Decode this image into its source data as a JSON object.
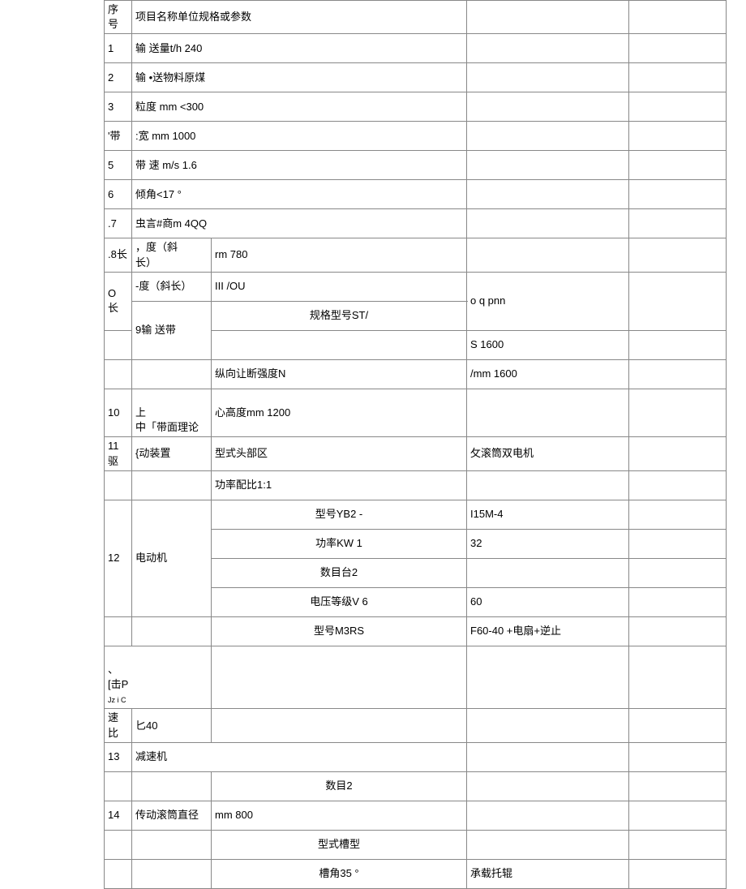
{
  "header": {
    "c1": "序号",
    "c2": "项目名称单位规格或参数"
  },
  "rows": {
    "r1": {
      "n": "1",
      "txt": "输 送量t/h 240"
    },
    "r2": {
      "n": "2",
      "txt": "输 •送物料原煤"
    },
    "r3": {
      "n": "3",
      "txt": "粒度 mm <300"
    },
    "r4": {
      "n": "'带",
      "txt": ":宽 mm 1000"
    },
    "r5": {
      "n": "5",
      "txt": "带 速 m/s 1.6"
    },
    "r6": {
      "n": "6",
      "txt": "倾角<17 °"
    },
    "r7": {
      "n": ".7",
      "txt": "虫言#商m 4QQ"
    },
    "r8": {
      "n": ".8",
      "a": "长",
      "b": "，度（斜\n长）",
      "c": "rm 780"
    },
    "r8b": {
      "n": "O\n长",
      "b": "-度（斜长）",
      "c": "III /OU",
      "d": "o q pnn"
    },
    "r9": {
      "n": "9",
      "a": "输 送带",
      "c3a": "规格型号ST/",
      "c4": "S 1600"
    },
    "r9b": {
      "c3": "纵向让断强度N",
      "c4": "/mm 1600"
    },
    "r10": {
      "n": "10",
      "a": "上\n中",
      "b": "「带面理论",
      "c": "心高度mm 1200"
    },
    "r11": {
      "n": "11\n驱",
      "b": "{动装置",
      "c3": "型式头部区",
      "c4": "攵滚筒双电机"
    },
    "r11b": {
      "c3": "功率配比1:1"
    },
    "r12a": {
      "c3": "型号YB2 -",
      "c4": "I15M-4"
    },
    "r12b": {
      "n": "12",
      "a": "电动机",
      "c3": "功率KW 1",
      "c4": "32"
    },
    "r12c": {
      "c3": "数目台2"
    },
    "r12d": {
      "c3": "电压等级V 6",
      "c4": "60"
    },
    "r12e": {
      "c3": "型号M3RS",
      "c4": "F60-40 +电扇+逆止"
    },
    "r12f": {
      "n": "、\n[击P",
      "tiny": "Jz i C"
    },
    "r12g": {
      "n": "速\n比",
      "b": "匕40"
    },
    "r13": {
      "n": "13",
      "a": "减速机"
    },
    "r13b": {
      "c3": "数目2"
    },
    "r14": {
      "n": "14",
      "a": "传动滚筒直径",
      "c3": "mm 800"
    },
    "r14b": {
      "c3": "型式槽型"
    },
    "r14c": {
      "c3": "槽角35 °",
      "c4": "承载托辊"
    }
  }
}
